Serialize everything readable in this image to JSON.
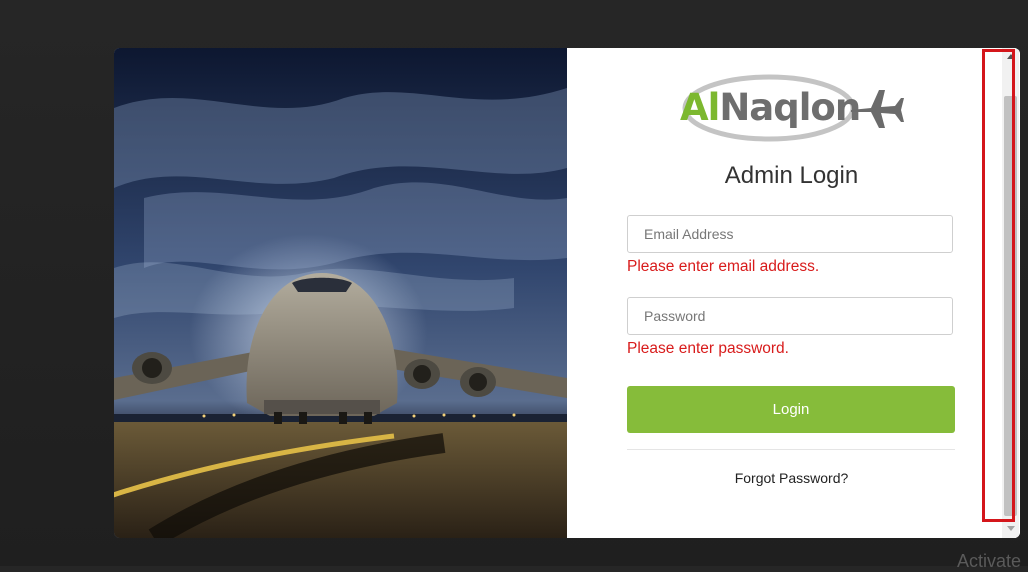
{
  "logo": {
    "text_part1": "Al",
    "text_part2": "Naqlon",
    "icon": "airplane-icon"
  },
  "login": {
    "title": "Admin Login",
    "email_placeholder": "Email Address",
    "email_value": "",
    "email_error": "Please enter email address.",
    "password_placeholder": "Password",
    "password_value": "",
    "password_error": "Please enter password.",
    "submit_label": "Login",
    "forgot_label": "Forgot Password?"
  },
  "os_watermark": "Activate",
  "colors": {
    "brand_green": "#86bc3a",
    "error_red": "#d81b1b",
    "highlight_red": "#d4161b",
    "backdrop": "#262626"
  }
}
